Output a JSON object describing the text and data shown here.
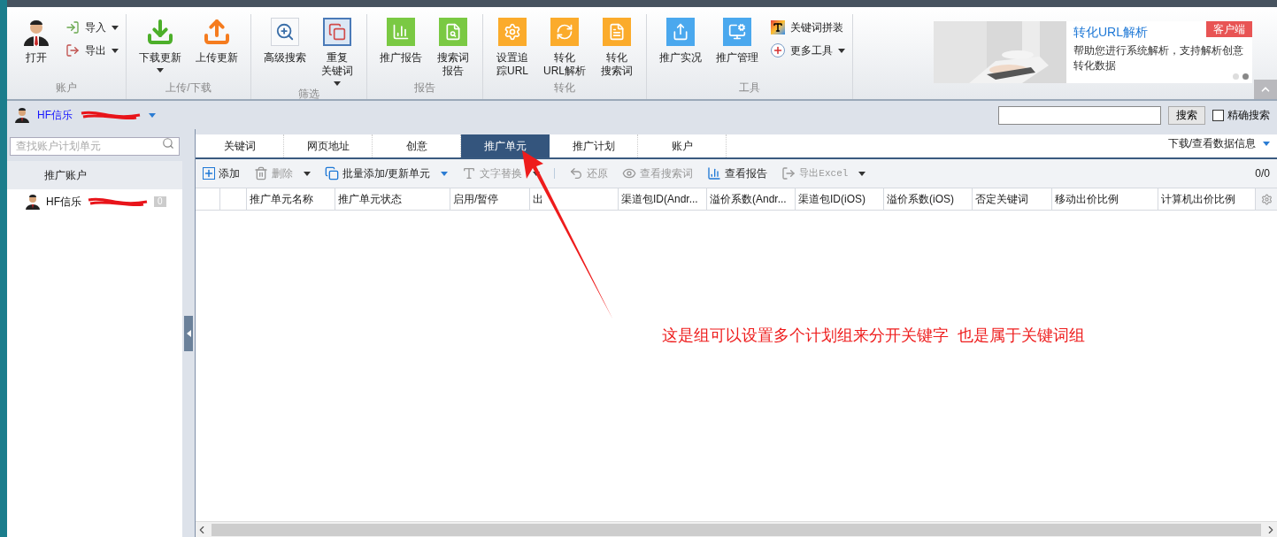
{
  "ribbon": {
    "groups": [
      {
        "label": "账户",
        "buttons": [
          {
            "kind": "big",
            "lines": [
              "打开"
            ],
            "dropdown": false
          },
          {
            "kind": "small",
            "lines": [
              "导入"
            ],
            "dropdown": true
          },
          {
            "kind": "small",
            "lines": [
              "导出"
            ],
            "dropdown": true
          }
        ]
      },
      {
        "label": "上传/下载",
        "buttons": [
          {
            "kind": "big",
            "lines": [
              "下载更新"
            ],
            "dropdown": true
          },
          {
            "kind": "big",
            "lines": [
              "上传更新"
            ],
            "dropdown": false
          }
        ]
      },
      {
        "label": "筛选",
        "buttons": [
          {
            "kind": "big",
            "lines": [
              "高级搜索"
            ],
            "dropdown": false
          },
          {
            "kind": "big",
            "lines": [
              "重复",
              "关键词"
            ],
            "dropdown": true
          }
        ]
      },
      {
        "label": "报告",
        "buttons": [
          {
            "kind": "big",
            "lines": [
              "推广报告"
            ],
            "dropdown": false
          },
          {
            "kind": "big",
            "lines": [
              "搜索词",
              "报告"
            ],
            "dropdown": false
          }
        ]
      },
      {
        "label": "转化",
        "buttons": [
          {
            "kind": "big",
            "lines": [
              "设置追",
              "踪URL"
            ],
            "dropdown": false
          },
          {
            "kind": "big",
            "lines": [
              "转化",
              "URL解析"
            ],
            "dropdown": false
          },
          {
            "kind": "big",
            "lines": [
              "转化",
              "搜索词"
            ],
            "dropdown": false
          }
        ]
      },
      {
        "label": "工具",
        "buttons": [
          {
            "kind": "big",
            "lines": [
              "推广实况"
            ],
            "dropdown": false
          },
          {
            "kind": "big",
            "lines": [
              "推广管理"
            ],
            "dropdown": false
          },
          {
            "kind": "small",
            "lines": [
              "关键词拼装"
            ],
            "dropdown": false
          },
          {
            "kind": "small",
            "lines": [
              "更多工具"
            ],
            "dropdown": true
          }
        ]
      }
    ]
  },
  "banner": {
    "title": "转化URL解析",
    "badge": "客户端",
    "description": "帮助您进行系统解析，支持解析创意转化数据",
    "dots": [
      {
        "selected": false
      },
      {
        "selected": true
      }
    ]
  },
  "account_bar": {
    "name": "HF信乐",
    "search": {
      "button": "搜索"
    },
    "exact": {
      "label": "精确搜索",
      "checked": false
    }
  },
  "sidebar": {
    "search": {
      "placeholder": "查找账户计划单元"
    },
    "header": "推广账户",
    "items": [
      {
        "name": "HF信乐",
        "count": "0"
      }
    ]
  },
  "tabs": [
    {
      "label": "关键词",
      "selected": false
    },
    {
      "label": "网页地址",
      "selected": false
    },
    {
      "label": "创意",
      "selected": false
    },
    {
      "label": "推广单元",
      "selected": true
    },
    {
      "label": "推广计划",
      "selected": false
    },
    {
      "label": "账户",
      "selected": false
    }
  ],
  "data_link": "下载/查看数据信息",
  "toolbar": {
    "items": [
      {
        "label": "添加",
        "disabled": false,
        "dropdown": false
      },
      {
        "label": "删除",
        "disabled": true,
        "dropdown": true
      },
      {
        "label": "批量添加/更新单元",
        "disabled": false,
        "dropdown": true
      },
      {
        "label": "文字替换",
        "disabled": true,
        "dropdown": true
      },
      {
        "label": "还原",
        "disabled": true,
        "dropdown": false
      },
      {
        "label": "查看搜索词",
        "disabled": true,
        "dropdown": false
      },
      {
        "label": "查看报告",
        "disabled": false,
        "dropdown": false
      },
      {
        "label": "导出Excel",
        "disabled": true,
        "dropdown": true
      }
    ],
    "count": "0/0"
  },
  "table": {
    "columns": [
      "",
      "",
      "推广单元名称",
      "推广单元状态",
      "启用/暂停",
      "出",
      "渠道包ID(Andr...",
      "溢价系数(Andr...",
      "渠道包ID(iOS)",
      "溢价系数(iOS)",
      "否定关键词",
      "移动出价比例",
      "计算机出价比例"
    ]
  },
  "annotation": "这是组可以设置多个计划组来分开关键字  也是属于关键词组"
}
